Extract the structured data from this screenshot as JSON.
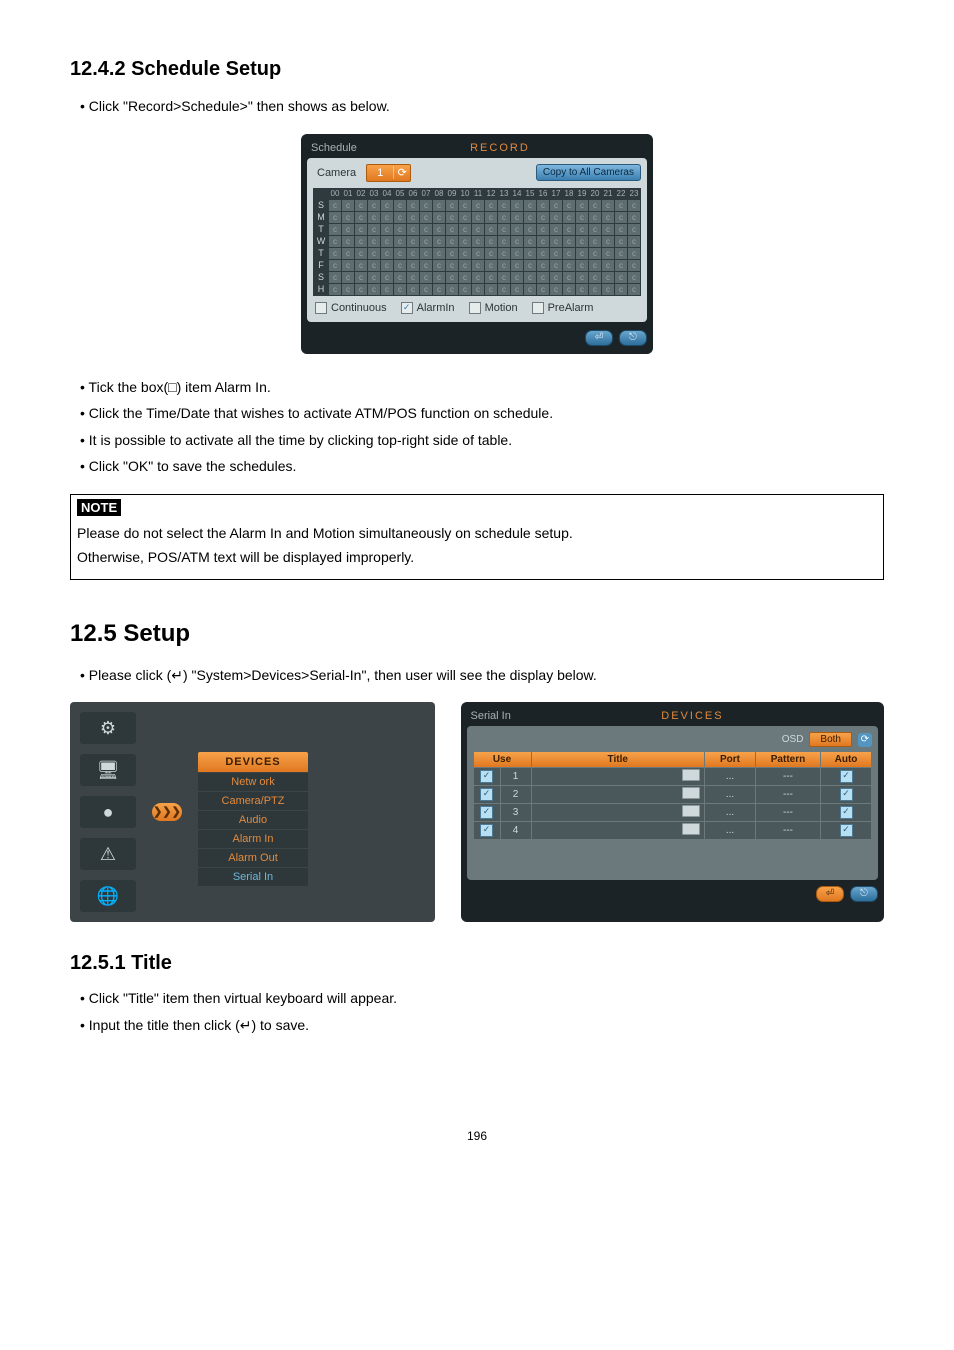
{
  "h_1242": "12.4.2  Schedule Setup",
  "b_1242": [
    "Click \"Record>Schedule>\" then shows as below."
  ],
  "schedule_panel": {
    "title_left": "Schedule",
    "title_right": "RECORD",
    "camera_label": "Camera",
    "camera_value": "1",
    "copy_btn": "Copy to All Cameras",
    "hours": [
      "00",
      "01",
      "02",
      "03",
      "04",
      "05",
      "06",
      "07",
      "08",
      "09",
      "10",
      "11",
      "12",
      "13",
      "14",
      "15",
      "16",
      "17",
      "18",
      "19",
      "20",
      "21",
      "22",
      "23"
    ],
    "days": [
      "S",
      "M",
      "T",
      "W",
      "T",
      "F",
      "S",
      "H"
    ],
    "cell_text": "c",
    "legend": {
      "continuous": "Continuous",
      "alarmin": "AlarmIn",
      "motion": "Motion",
      "prealarm": "PreAlarm"
    },
    "ok_glyph": "⏎",
    "exit_glyph": "⎋"
  },
  "b_1242_after": [
    "Tick the box(□) item Alarm In.",
    "Click the Time/Date that wishes to activate ATM/POS function on schedule.",
    "It is possible to activate all the time by clicking top-right side of table.",
    "Click \"OK\" to save the schedules."
  ],
  "note_label": "NOTE",
  "note_lines": [
    "Please do not select the Alarm In and Motion simultaneously on schedule setup.",
    "Otherwise, POS/ATM text will be displayed improperly."
  ],
  "h_125": "12.5  Setup",
  "b_125": [
    "Please click (↵) \"System>Devices>Serial-In\", then user will see the display below."
  ],
  "left_menu": {
    "chevron": "❯❯❯",
    "header": "DEVICES",
    "items": [
      "Netw ork",
      "Camera/PTZ",
      "Audio",
      "Alarm In",
      "Alarm Out",
      "Serial In"
    ]
  },
  "serial_panel": {
    "title_left": "Serial In",
    "title_right": "DEVICES",
    "osd_label": "OSD",
    "both_btn": "Both",
    "headers": {
      "use": "Use",
      "title": "Title",
      "port": "Port",
      "pattern": "Pattern",
      "auto": "Auto"
    },
    "rows": [
      {
        "no": "1",
        "port": "...",
        "pattern": "---"
      },
      {
        "no": "2",
        "port": "...",
        "pattern": "---"
      },
      {
        "no": "3",
        "port": "...",
        "pattern": "---"
      },
      {
        "no": "4",
        "port": "...",
        "pattern": "---"
      }
    ]
  },
  "h_1251": "12.5.1  Title",
  "b_1251": [
    "Click \"Title\" item then virtual keyboard will appear.",
    "Input the title then click (↵) to save."
  ],
  "page_number": "196"
}
